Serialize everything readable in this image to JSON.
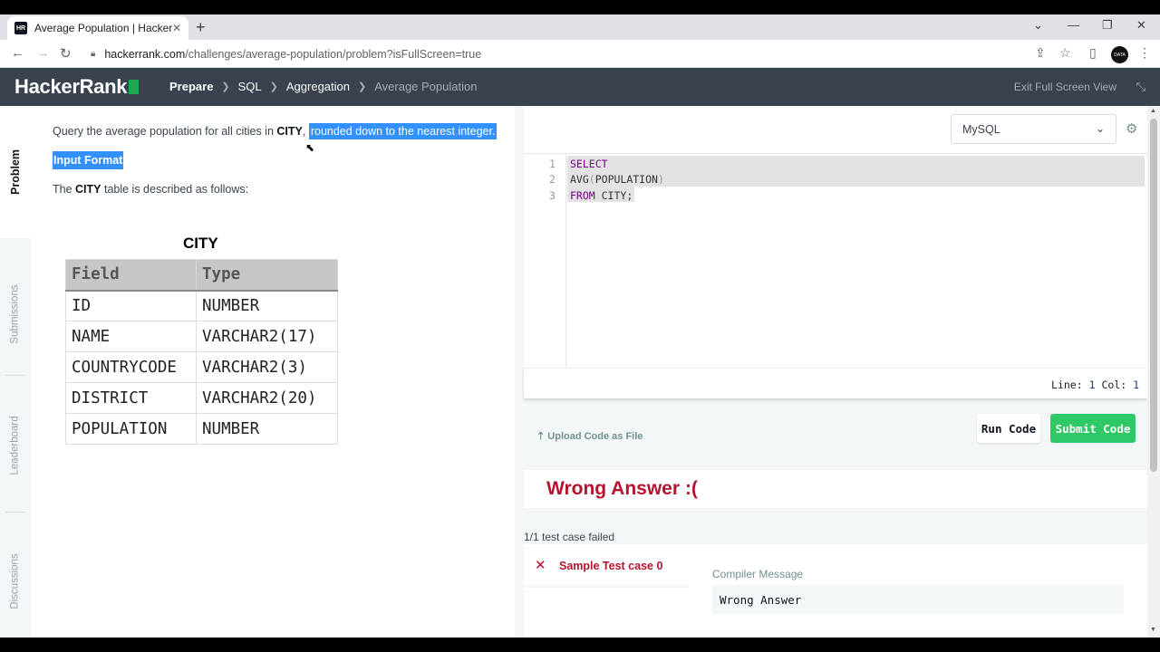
{
  "browser": {
    "tab_title": "Average Population | HackerRank",
    "favicon_text": "HR",
    "url_host": "hackerrank.com",
    "url_path": "/challenges/average-population/problem?isFullScreen=true",
    "profile_text": "DATA"
  },
  "header": {
    "logo": "HackerRank",
    "breadcrumbs": [
      "Prepare",
      "SQL",
      "Aggregation",
      "Average Population"
    ],
    "exit_fullscreen": "Exit Full Screen View"
  },
  "sidebar": {
    "tabs": [
      "Problem",
      "Submissions",
      "Leaderboard",
      "Discussions"
    ]
  },
  "problem": {
    "statement_pre": "Query the average population for all cities in ",
    "statement_city": "CITY",
    "statement_comma": ",",
    "statement_highlight": "rounded down to the nearest integer.",
    "input_format": "Input Format",
    "desc_pre": "The ",
    "desc_city": "CITY",
    "desc_post": " table is described as follows:",
    "table_title": "CITY",
    "table_headers": [
      "Field",
      "Type"
    ],
    "table_rows": [
      [
        "ID",
        "NUMBER"
      ],
      [
        "NAME",
        "VARCHAR2(17)"
      ],
      [
        "COUNTRYCODE",
        "VARCHAR2(3)"
      ],
      [
        "DISTRICT",
        "VARCHAR2(20)"
      ],
      [
        "POPULATION",
        "NUMBER"
      ]
    ]
  },
  "editor": {
    "language": "MySQL",
    "line_numbers": [
      "1",
      "2",
      "3"
    ],
    "code": {
      "line1_kw": "SELECT",
      "line2_fn": "AVG",
      "line2_open": "(",
      "line2_arg": "POPULATION",
      "line2_close": ")",
      "line3_kw": "FROM",
      "line3_rest": " CITY;"
    },
    "status_line_label": "Line: ",
    "status_line": "1",
    "status_col_label": " Col: ",
    "status_col": "1",
    "upload_label": "Upload Code as File",
    "run_label": "Run Code",
    "submit_label": "Submit Code"
  },
  "result": {
    "title": "Wrong Answer :(",
    "summary": "1/1 test case failed",
    "testcase_label": "Sample Test case 0",
    "compiler_title": "Compiler Message",
    "compiler_message": "Wrong Answer"
  },
  "colors": {
    "brand_green": "#1ba94c",
    "header_bg": "#39424e",
    "error_red": "#b7132f",
    "submit_green": "#2ec866",
    "selection_blue": "#3390ff"
  }
}
